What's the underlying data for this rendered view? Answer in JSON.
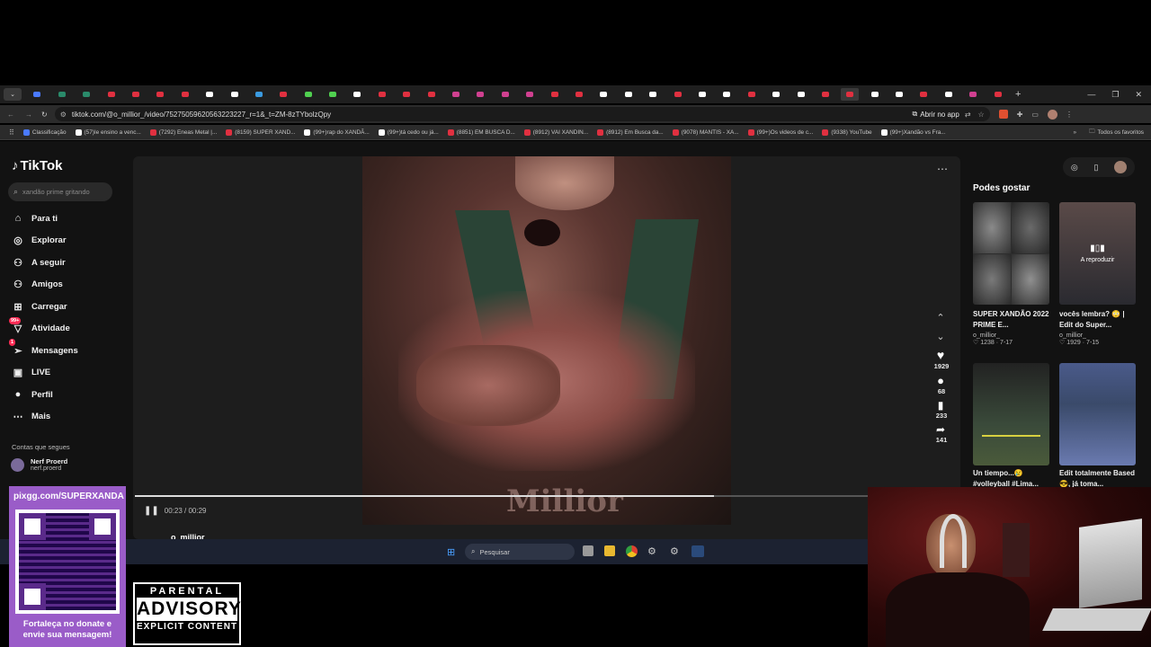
{
  "browser": {
    "url": "tiktok.com/@o_millior_/video/75275059620563223227_r=1&_t=ZM-8zTYbolzQpy",
    "open_in_app": "Abrir no app",
    "bookmarks": [
      "Classificação",
      "(57)Ie ensino a venc...",
      "(7292) Eneas Metal |...",
      "(8159) SUPER XAND...",
      "(99+)rap do XANDÃ...",
      "(99+)tá cedo ou já...",
      "(8851) EM BUSCA D...",
      "(8912) VAI XANDIN...",
      "(8912) Em Busca da...",
      "(9078) MANTIS - XA...",
      "(99+)Os videos de c...",
      "(9338) YouTube",
      "(99+)Xandão vs Fra..."
    ],
    "all_favorites": "Todos os favoritos"
  },
  "tiktok": {
    "logo": "TikTok",
    "search_placeholder": "xandão prime gritando",
    "nav": [
      {
        "label": "Para ti",
        "icon": "home-icon"
      },
      {
        "label": "Explorar",
        "icon": "compass-icon"
      },
      {
        "label": "A seguir",
        "icon": "following-icon"
      },
      {
        "label": "Amigos",
        "icon": "friends-icon"
      },
      {
        "label": "Carregar",
        "icon": "upload-icon"
      },
      {
        "label": "Atividade",
        "icon": "activity-icon",
        "badge": "99+"
      },
      {
        "label": "Mensagens",
        "icon": "messages-icon",
        "badge": "1"
      },
      {
        "label": "LIVE",
        "icon": "live-icon"
      },
      {
        "label": "Perfil",
        "icon": "profile-icon"
      },
      {
        "label": "Mais",
        "icon": "more-icon"
      }
    ],
    "following_header": "Contas que segues",
    "following": [
      {
        "name": "Nerf Proerd",
        "handle": "nerf.proerd"
      }
    ],
    "video": {
      "time": "00:23 / 00:29",
      "progress": 0.79,
      "author": "o_millior_",
      "watermark": "Millior"
    },
    "actions": {
      "likes": "1929",
      "comments": "68",
      "saves": "233",
      "shares": "141"
    },
    "related_header": "Podes gostar",
    "related": [
      {
        "title": "SUPER XANDÃO 2022 PRIME E...",
        "author": "o_millior_",
        "likes": "1238",
        "date": "7-17"
      },
      {
        "title": "vocês lembra? 😳 | Edit do Super...",
        "author": "o_millior_",
        "likes": "1929",
        "date": "7-15",
        "overlay": "A reproduzir"
      },
      {
        "title": "Un tiempo...😢 #volleyball #Lima...",
        "author": "",
        "likes": "",
        "date": ""
      },
      {
        "title": "Edit totalmente Based 😎, já toma...",
        "author": "",
        "likes": "",
        "date": ""
      }
    ]
  },
  "taskbar": {
    "search": "Pesquisar"
  },
  "overlay": {
    "pix_url": "pixgg.com/SUPERXANDA",
    "donate_text": "Fortaleça no donate e envie sua mensagem!",
    "parental_top": "PARENTAL",
    "parental_mid": "ADVISORY",
    "parental_bottom": "EXPLICIT CONTENT"
  }
}
